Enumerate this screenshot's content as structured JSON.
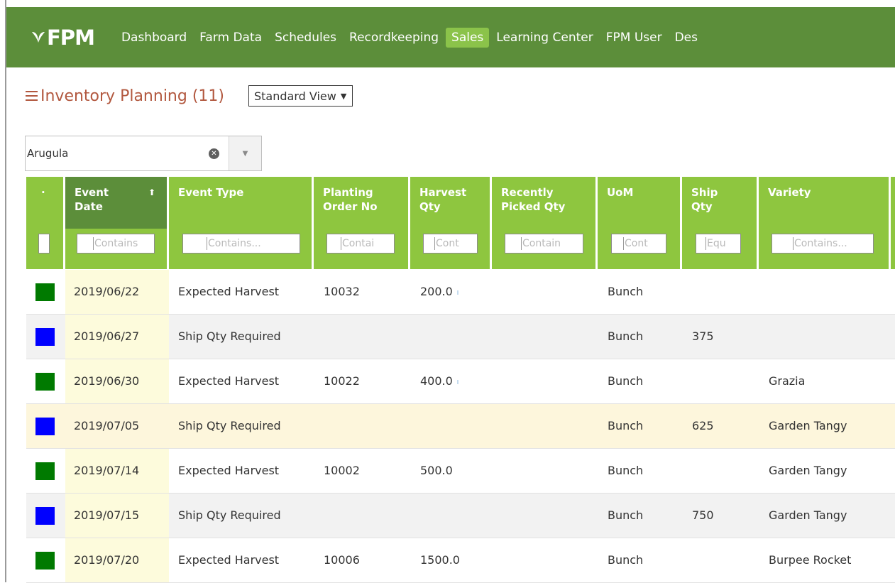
{
  "app": {
    "logo_text": "FPM",
    "nav": [
      "Dashboard",
      "Farm Data",
      "Schedules",
      "Recordkeeping",
      "Sales",
      "Learning Center",
      "FPM User",
      "Des"
    ],
    "active_nav": "Sales"
  },
  "page": {
    "title": "Inventory Planning (11)",
    "view_select": "Standard View"
  },
  "filter": {
    "value": "Arugula"
  },
  "grid": {
    "columns": [
      {
        "key": "marker",
        "label": "·",
        "filter_placeholder": ""
      },
      {
        "key": "event_date",
        "label": "Event\nDate",
        "filter_placeholder": "Contains",
        "sorted": "asc"
      },
      {
        "key": "event_type",
        "label": "Event Type",
        "filter_placeholder": "Contains..."
      },
      {
        "key": "planting_order_no",
        "label": "Planting\nOrder No",
        "filter_placeholder": "Contai"
      },
      {
        "key": "harvest_qty",
        "label": "Harvest\nQty",
        "filter_placeholder": "Cont"
      },
      {
        "key": "recently_picked_qty",
        "label": "Recently\nPicked Qty",
        "filter_placeholder": "Contain"
      },
      {
        "key": "uom",
        "label": "UoM",
        "filter_placeholder": "Cont"
      },
      {
        "key": "ship_qty",
        "label": "Ship\nQty",
        "filter_placeholder": "Equ"
      },
      {
        "key": "variety",
        "label": "Variety",
        "filter_placeholder": "Contains..."
      }
    ],
    "rows": [
      {
        "color": "#007a00",
        "event_date": "2019/06/22",
        "event_type": "Expected Harvest",
        "planting_order_no": "10032",
        "harvest_qty": "200.0",
        "recently_picked_qty": "",
        "uom": "Bunch",
        "ship_qty": "",
        "variety": ""
      },
      {
        "color": "#0000ff",
        "event_date": "2019/06/27",
        "event_type": "Ship Qty Required",
        "planting_order_no": "",
        "harvest_qty": "",
        "recently_picked_qty": "",
        "uom": "Bunch",
        "ship_qty": "375",
        "variety": ""
      },
      {
        "color": "#007a00",
        "event_date": "2019/06/30",
        "event_type": "Expected Harvest",
        "planting_order_no": "10022",
        "harvest_qty": "400.0",
        "recently_picked_qty": "",
        "uom": "Bunch",
        "ship_qty": "",
        "variety": "Grazia"
      },
      {
        "color": "#0000ff",
        "event_date": "2019/07/05",
        "event_type": "Ship Qty Required",
        "planting_order_no": "",
        "harvest_qty": "",
        "recently_picked_qty": "",
        "uom": "Bunch",
        "ship_qty": "625",
        "variety": "Garden Tangy"
      },
      {
        "color": "#007a00",
        "event_date": "2019/07/14",
        "event_type": "Expected Harvest",
        "planting_order_no": "10002",
        "harvest_qty": "500.0",
        "recently_picked_qty": "",
        "uom": "Bunch",
        "ship_qty": "",
        "variety": "Garden Tangy"
      },
      {
        "color": "#0000ff",
        "event_date": "2019/07/15",
        "event_type": "Ship Qty Required",
        "planting_order_no": "",
        "harvest_qty": "",
        "recently_picked_qty": "",
        "uom": "Bunch",
        "ship_qty": "750",
        "variety": "Garden Tangy"
      },
      {
        "color": "#007a00",
        "event_date": "2019/07/20",
        "event_type": "Expected Harvest",
        "planting_order_no": "10006",
        "harvest_qty": "1500.0",
        "recently_picked_qty": "",
        "uom": "Bunch",
        "ship_qty": "",
        "variety": "Burpee Rocket"
      }
    ]
  }
}
